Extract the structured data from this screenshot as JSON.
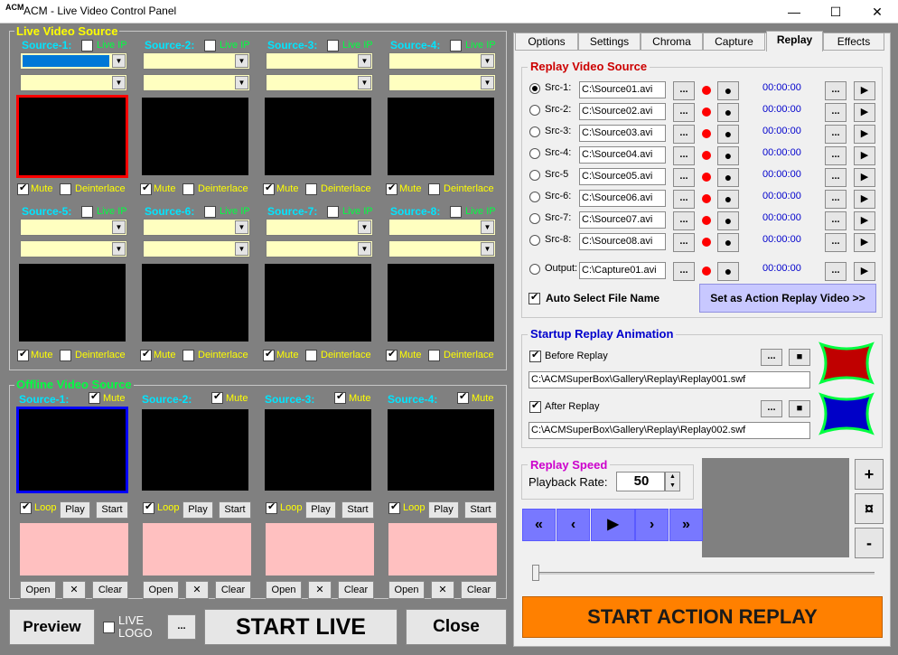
{
  "window": {
    "title": "ACM - Live Video Control Panel",
    "logo": "ACM",
    "minimize": "—",
    "maximize": "☐",
    "close": "✕"
  },
  "live": {
    "title": "Live Video Source",
    "row1": [
      {
        "label": "Source-1:",
        "liveip": "Live IP"
      },
      {
        "label": "Source-2:",
        "liveip": "Live IP"
      },
      {
        "label": "Source-3:",
        "liveip": "Live IP"
      },
      {
        "label": "Source-4:",
        "liveip": "Live IP"
      }
    ],
    "row2": [
      {
        "label": "Source-5:",
        "liveip": "Live IP"
      },
      {
        "label": "Source-6:",
        "liveip": "Live IP"
      },
      {
        "label": "Source-7:",
        "liveip": "Live IP"
      },
      {
        "label": "Source-8:",
        "liveip": "Live IP"
      }
    ],
    "mute": "Mute",
    "deinterlace": "Deinterlace"
  },
  "offline": {
    "title": "Offline Video Source",
    "sources": [
      {
        "label": "Source-1:"
      },
      {
        "label": "Source-2:"
      },
      {
        "label": "Source-3:"
      },
      {
        "label": "Source-4:"
      }
    ],
    "mute": "Mute",
    "loop": "Loop",
    "play": "Play",
    "start": "Start",
    "open": "Open",
    "x": "✕",
    "clear": "Clear"
  },
  "bottom": {
    "preview": "Preview",
    "live_logo": "LIVE LOGO",
    "dots": "...",
    "start_live": "START LIVE",
    "close": "Close"
  },
  "tabs": [
    {
      "label": "Options"
    },
    {
      "label": "Settings"
    },
    {
      "label": "Chroma"
    },
    {
      "label": "Capture"
    },
    {
      "label": "Replay"
    },
    {
      "label": "Effects"
    }
  ],
  "replay_source": {
    "title": "Replay Video Source",
    "rows": [
      {
        "label": "Src-1:",
        "file": "C:\\Source01.avi",
        "time": "00:00:00"
      },
      {
        "label": "Src-2:",
        "file": "C:\\Source02.avi",
        "time": "00:00:00"
      },
      {
        "label": "Src-3:",
        "file": "C:\\Source03.avi",
        "time": "00:00:00"
      },
      {
        "label": "Src-4:",
        "file": "C:\\Source04.avi",
        "time": "00:00:00"
      },
      {
        "label": "Src-5",
        "file": "C:\\Source05.avi",
        "time": "00:00:00"
      },
      {
        "label": "Src-6:",
        "file": "C:\\Source06.avi",
        "time": "00:00:00"
      },
      {
        "label": "Src-7:",
        "file": "C:\\Source07.avi",
        "time": "00:00:00"
      },
      {
        "label": "Src-8:",
        "file": "C:\\Source08.avi",
        "time": "00:00:00"
      }
    ],
    "output": {
      "label": "Output:",
      "file": "C:\\Capture01.avi",
      "time": "00:00:00"
    },
    "browse": "...",
    "record": "●",
    "play": "▶",
    "auto_select": "Auto Select File Name",
    "set_replay": "Set as Action Replay Video >>"
  },
  "startup": {
    "title": "Startup Replay Animation",
    "before_label": "Before Replay",
    "before_path": "C:\\ACMSuperBox\\Gallery\\Replay\\Replay001.swf",
    "after_label": "After Replay",
    "after_path": "C:\\ACMSuperBox\\Gallery\\Replay\\Replay002.swf",
    "browse": "...",
    "stop": "■"
  },
  "speed": {
    "title": "Replay Speed",
    "rate_label": "Playback Rate:",
    "rate_value": "50"
  },
  "transport": [
    "«",
    "‹",
    "▶",
    "›",
    "»"
  ],
  "side_buttons": [
    "+",
    "¤",
    "-"
  ],
  "start_replay": "START ACTION REPLAY",
  "colors": {
    "live_title": "#ffff00",
    "offline_title": "#00ff40",
    "source_label": "#00e5ff",
    "replay_title": "#cc0000",
    "startup_title": "#0000cc",
    "speed_title": "#cc00cc",
    "start_replay_bg": "#ff8000",
    "nav_bg": "#7878ff"
  }
}
